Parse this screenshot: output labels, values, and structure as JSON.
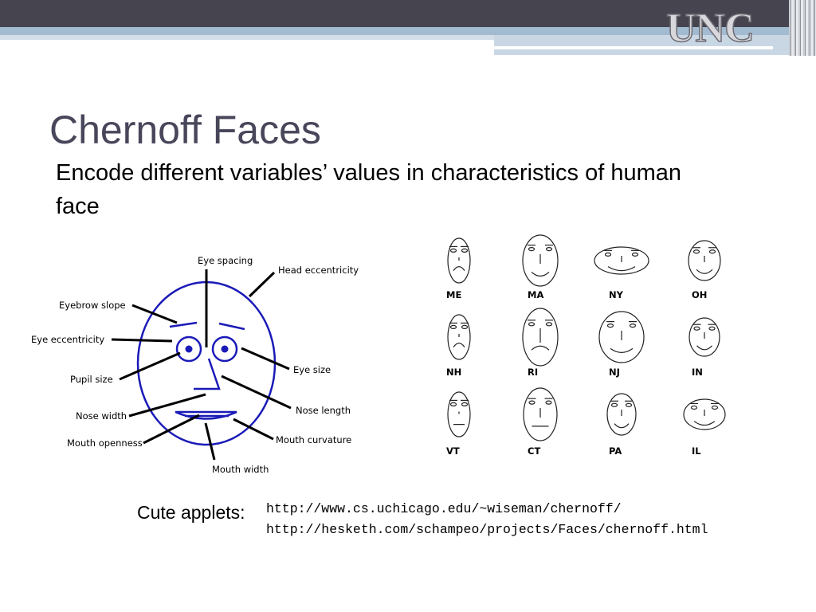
{
  "header": {
    "logo": "UNC"
  },
  "title": "Chernoff Faces",
  "subtitle": "Encode different variables’ values in characteristics of human face",
  "diagram": {
    "labels": [
      "Eye spacing",
      "Head eccentricity",
      "Eyebrow slope",
      "Eye eccentricity",
      "Pupil size",
      "Eye size",
      "Nose length",
      "Nose width",
      "Mouth openness",
      "Mouth curvature",
      "Mouth width"
    ]
  },
  "faces": {
    "labels": [
      "ME",
      "MA",
      "NY",
      "OH",
      "NH",
      "RI",
      "NJ",
      "IN",
      "VT",
      "CT",
      "PA",
      "IL"
    ]
  },
  "applets": {
    "label": "Cute applets:",
    "links": [
      "http://www.cs.uchicago.edu/~wiseman/chernoff/",
      "http://hesketh.com/schampeo/projects/Faces/chernoff.html"
    ]
  },
  "colors": {
    "header_dark": "#45444f",
    "header_blue": "#a3bbd1",
    "face_blue": "#1a1ab8",
    "title": "#47465a"
  }
}
